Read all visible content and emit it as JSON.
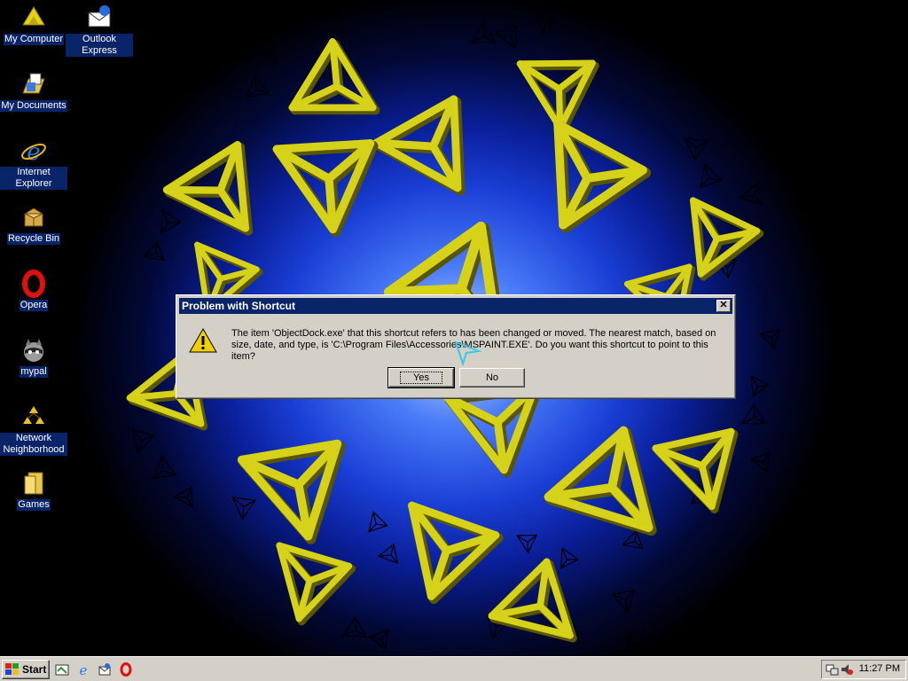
{
  "desktop": {
    "icons": [
      {
        "name": "my-computer",
        "label": "My Computer",
        "icon": "computer-icon"
      },
      {
        "name": "outlook-express",
        "label": "Outlook Express",
        "icon": "outlook-express-icon"
      },
      {
        "name": "my-documents",
        "label": "My Documents",
        "icon": "folder-documents-icon"
      },
      {
        "name": "internet-explorer",
        "label": "Internet Explorer",
        "icon": "internet-explorer-icon"
      },
      {
        "name": "recycle-bin",
        "label": "Recycle Bin",
        "icon": "recycle-bin-icon"
      },
      {
        "name": "opera",
        "label": "Opera",
        "icon": "opera-icon"
      },
      {
        "name": "mypal",
        "label": "mypal",
        "icon": "raccoon-icon"
      },
      {
        "name": "network-neighborhood",
        "label": "Network Neighborhood",
        "icon": "network-icon"
      },
      {
        "name": "games",
        "label": "Games",
        "icon": "folder-icon"
      }
    ]
  },
  "dialog": {
    "title": "Problem with Shortcut",
    "icon": "warning-icon",
    "message": "The item 'ObjectDock.exe' that this shortcut refers to has been changed or moved. The nearest match, based on size, date, and type, is 'C:\\Program Files\\Accessories\\MSPAINT.EXE'. Do you want this shortcut to point to this item?",
    "yes_label": "Yes",
    "no_label": "No",
    "close_glyph": "✕"
  },
  "taskbar": {
    "start_label": "Start",
    "quick_launch": [
      "show-desktop-icon",
      "internet-explorer-icon",
      "outlook-express-icon",
      "opera-icon"
    ],
    "clock": "11:27 PM"
  },
  "colors": {
    "titlebar": "#0a246a",
    "face": "#d4d0c8",
    "wallpaper_object": "#d6d21a"
  }
}
